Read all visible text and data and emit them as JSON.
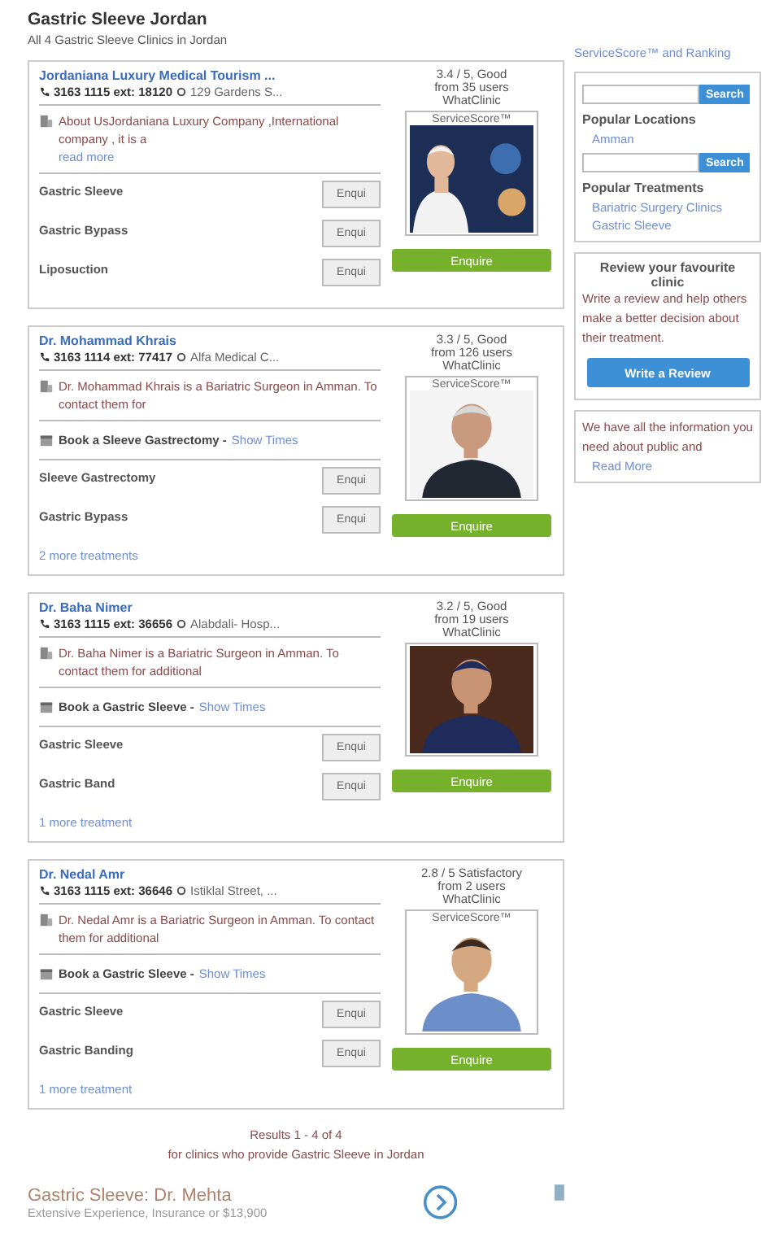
{
  "page_title": "Gastric Sleeve Jordan",
  "subtitle": "All 4 Gastric Sleeve Clinics in Jordan",
  "clinics": [
    {
      "name": "Jordaniana Luxury Medical Tourism ...",
      "phone": "3163 1115 ext: 18120",
      "location": "129 Gardens S...",
      "description": "About UsJordaniana Luxury Company ,International company , it is a",
      "read_more": "read more",
      "treatments": [
        {
          "name": "Gastric Sleeve",
          "button": "Enqui"
        },
        {
          "name": "Gastric Bypass",
          "button": "Enqui"
        },
        {
          "name": "Liposuction",
          "button": "Enqui"
        }
      ],
      "rating": "3.4 / 5, Good",
      "reviews": "from 35 users",
      "source": "WhatClinic",
      "score_label": "ServiceScore™",
      "enquire": "Enquire"
    },
    {
      "name": "Dr. Mohammad Khrais",
      "phone": "3163 1114 ext: 77417",
      "location": "Alfa Medical C...",
      "description": "Dr. Mohammad Khrais is a Bariatric Surgeon in Amman. To contact them for",
      "booking": {
        "title": "Book a Sleeve Gastrectomy -",
        "link": "Show Times"
      },
      "treatments": [
        {
          "name": "Sleeve Gastrectomy",
          "button": "Enqui"
        },
        {
          "name": "Gastric Bypass",
          "button": "Enqui"
        }
      ],
      "more": "2 more treatments",
      "rating": "3.3 / 5, Good",
      "reviews": "from 126 users",
      "source": "WhatClinic",
      "score_label": "ServiceScore™",
      "enquire": "Enquire"
    },
    {
      "name": "Dr. Baha Nimer",
      "phone": "3163 1115 ext: 36656",
      "location": "Alabdali- Hosp...",
      "description": "Dr. Baha Nimer is a Bariatric Surgeon in Amman. To contact them for additional",
      "booking": {
        "title": "Book a Gastric Sleeve -",
        "link": "Show Times"
      },
      "treatments": [
        {
          "name": "Gastric Sleeve",
          "button": "Enqui"
        },
        {
          "name": "Gastric Band",
          "button": "Enqui"
        }
      ],
      "more": "1 more treatment",
      "rating": "3.2 / 5, Good",
      "reviews": "from 19 users",
      "source": "WhatClinic",
      "enquire": "Enquire"
    },
    {
      "name": "Dr. Nedal Amr",
      "phone": "3163 1115 ext: 36646",
      "location": "Istiklal Street, ...",
      "description": "Dr. Nedal Amr is a Bariatric Surgeon in Amman. To contact them for additional",
      "booking": {
        "title": "Book a Gastric Sleeve -",
        "link": "Show Times"
      },
      "treatments": [
        {
          "name": "Gastric Sleeve",
          "button": "Enqui"
        },
        {
          "name": "Gastric Banding",
          "button": "Enqui"
        }
      ],
      "more": "1 more treatment",
      "rating": "2.8 / 5 Satisfactory",
      "reviews": "from 2 users",
      "source": "WhatClinic",
      "score_label": "ServiceScore™",
      "enquire": "Enquire"
    }
  ],
  "results": {
    "count": "Results 1 - 4 of 4",
    "caption": "for clinics who provide Gastric Sleeve in Jordan"
  },
  "ad": {
    "title": "Gastric Sleeve: Dr. Mehta",
    "text": "Extensive Experience, Insurance or $13,900"
  },
  "sidebar": {
    "score_note": "ServiceScore™ and Ranking",
    "location_search_button": "Search",
    "locations_title": "Popular Locations",
    "locations": [
      "Amman"
    ],
    "treatment_search_button": "Search",
    "treatments_title": "Popular Treatments",
    "treatments": [
      "Bariatric Surgery Clinics",
      "Gastric Sleeve"
    ],
    "review": {
      "title": "Review your favourite clinic",
      "text": "Write a review and help others make a better decision about their treatment.",
      "button": "Write a Review"
    },
    "info": {
      "text": "We have all the information you need about public and",
      "link": "Read More"
    }
  }
}
